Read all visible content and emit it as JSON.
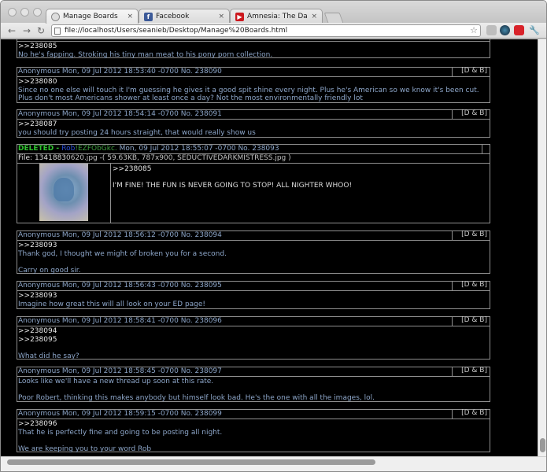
{
  "browser": {
    "tabs": [
      {
        "title": "Manage Boards",
        "icon": "globe-icon"
      },
      {
        "title": "Facebook",
        "icon": "facebook-icon"
      },
      {
        "title": "Amnesia: The Dark Descent",
        "icon": "youtube-icon"
      }
    ],
    "url": "file://localhost/Users/seanieb/Desktop/Manage%20Boards.html",
    "close_glyph": "×"
  },
  "db_label": "[D & B]",
  "posts": [
    {
      "header": "",
      "lines": [
        ">>238085",
        "No he's fapping. Stroking his tiny man meat to his pony porn collection."
      ]
    },
    {
      "header": "Anonymous Mon, 09 Jul 2012 18:53:40 -0700 No. 238090",
      "lines": [
        ">>238080",
        "Since no one else will touch it I'm guessing he gives it a good spit shine every night. Plus he's American so we know it's been cut. Plus don't most Americans shower at least once a day? Not the most environmentally friendly lot"
      ]
    },
    {
      "header": "Anonymous Mon, 09 Jul 2012 18:54:14 -0700 No. 238091",
      "lines": [
        ">>238087",
        "you should try posting 24 hours straight, that would really show us"
      ]
    },
    {
      "deleted_label": "DELETED",
      "dash": " - ",
      "name": "Rob",
      "trip": "!EZFObGkc.",
      "header_rest": " Mon, 09 Jul 2012 18:55:07 -0700 No. 238093",
      "file": "File: 1341883",
      "file_rest": "0620.jpg -( 59.63KB, 787x900, SEDUCTIVEDARKMISTRESS.jpg )",
      "lines": [
        ">>238085",
        "",
        "I'M FINE! THE FUN IS NEVER GOING TO STOP! ALL NIGHTER WHOO!"
      ]
    },
    {
      "header": "Anonymous Mon, 09 Jul 2012 18:56:12 -0700 No. 238094",
      "lines": [
        ">>238093",
        "Thank god, I thought we might of broken you for a second.",
        "",
        "Carry on good sir."
      ]
    },
    {
      "header": "Anonymous Mon, 09 Jul 2012 18:56:43 -0700 No. 238095",
      "lines": [
        ">>238093",
        "Imagine how great this will all look on your ED page!"
      ]
    },
    {
      "header": "Anonymous Mon, 09 Jul 2012 18:58:41 -0700 No. 238096",
      "lines": [
        ">>238094",
        ">>238095",
        "",
        "What did he say?"
      ]
    },
    {
      "header": "Anonymous Mon, 09 Jul 2012 18:58:45 -0700 No. 238097",
      "lines": [
        "Looks like we'll have a new thread up soon at this rate.",
        "",
        "Poor Robert, thinking this makes anybody but himself look bad. He's the one with all the images, lol."
      ]
    },
    {
      "header": "Anonymous Mon, 09 Jul 2012 18:59:15 -0700 No. 238099",
      "lines": [
        ">>238096",
        "That he is perfectly fine and going to be posting all night.",
        "",
        "We are keeping you to your word Rob"
      ]
    }
  ]
}
